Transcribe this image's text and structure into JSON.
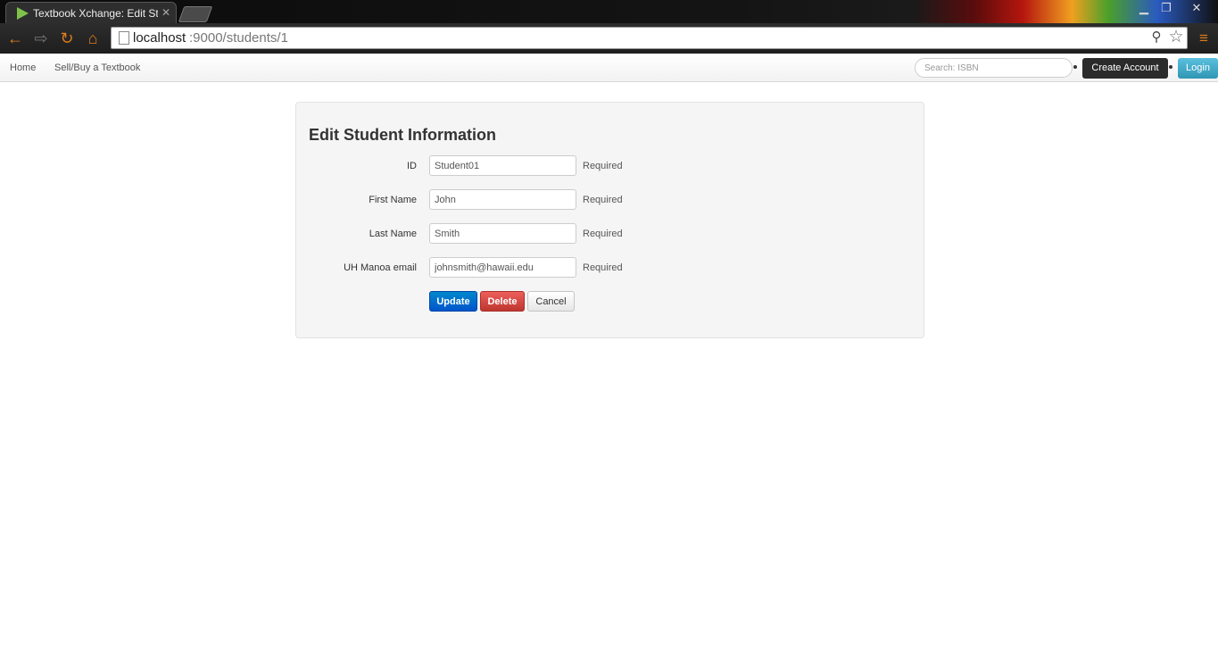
{
  "browser": {
    "tab_title": "Textbook Xchange: Edit St",
    "tab_close": "✕",
    "window_controls": {
      "minimize": "▁",
      "maximize": "❐",
      "close": "✕"
    },
    "url_host": "localhost",
    "url_rest": ":9000/students/1",
    "icons": [
      "back-arrow-icon",
      "forward-arrow-icon",
      "reload-icon",
      "home-icon",
      "page-icon",
      "zoom-icon",
      "star-icon",
      "menu-icon"
    ]
  },
  "navbar": {
    "home": "Home",
    "sell_buy": "Sell/Buy a Textbook",
    "search_placeholder": "Search: ISBN",
    "create_account": "Create Account",
    "login": "Login"
  },
  "form": {
    "title": "Edit Student Information",
    "fields": [
      {
        "label": "ID",
        "value": "Student01",
        "help": "Required"
      },
      {
        "label": "First Name",
        "value": "John",
        "help": "Required"
      },
      {
        "label": "Last Name",
        "value": "Smith",
        "help": "Required"
      },
      {
        "label": "UH Manoa email",
        "value": "johnsmith@hawaii.edu",
        "help": "Required"
      }
    ],
    "buttons": {
      "update": "Update",
      "delete": "Delete",
      "cancel": "Cancel"
    }
  },
  "colors": {
    "update": "#0062cc",
    "delete": "#da4f49",
    "login": "#49afcd",
    "create_account": "#2b2b2b",
    "panel_bg": "#f5f5f5"
  }
}
